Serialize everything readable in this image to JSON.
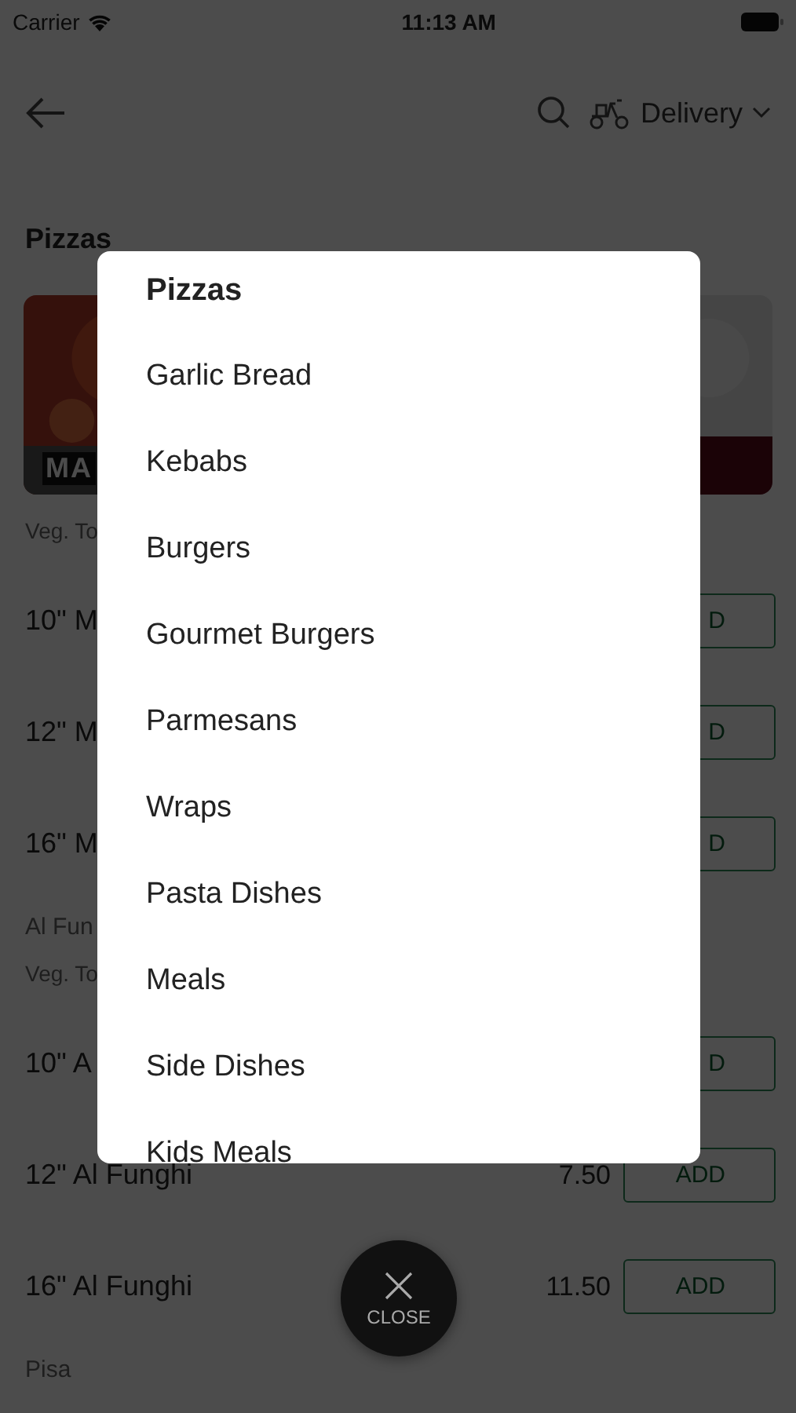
{
  "status_bar": {
    "carrier": "Carrier",
    "time": "11:13 AM"
  },
  "header": {
    "delivery_label": "Delivery"
  },
  "section_title": "Pizzas",
  "cards": [
    {
      "kind": "picture",
      "label": "MA"
    },
    {
      "kind": "picture"
    }
  ],
  "groups": [
    {
      "description": "Veg. To",
      "items": [
        {
          "name": "10\" M",
          "button": "D"
        },
        {
          "name": "12\" M",
          "button": "D"
        },
        {
          "name": "16\" M",
          "button": "D"
        }
      ]
    },
    {
      "name": "Al Fun",
      "description": "Veg. To",
      "items": [
        {
          "name": "10\" A",
          "button": "D"
        },
        {
          "name": "12\" Al Funghi",
          "price": "7.50",
          "button": "ADD"
        },
        {
          "name": "16\" Al Funghi",
          "price": "11.50",
          "button": "ADD"
        }
      ]
    },
    {
      "name": "Pisa"
    }
  ],
  "category_menu": {
    "title": "Pizzas",
    "items": [
      "Garlic Bread",
      "Kebabs",
      "Burgers",
      "Gourmet Burgers",
      "Parmesans",
      "Wraps",
      "Pasta Dishes",
      "Meals",
      "Side Dishes",
      "Kids Meals"
    ]
  },
  "close_button": {
    "label": "CLOSE"
  }
}
